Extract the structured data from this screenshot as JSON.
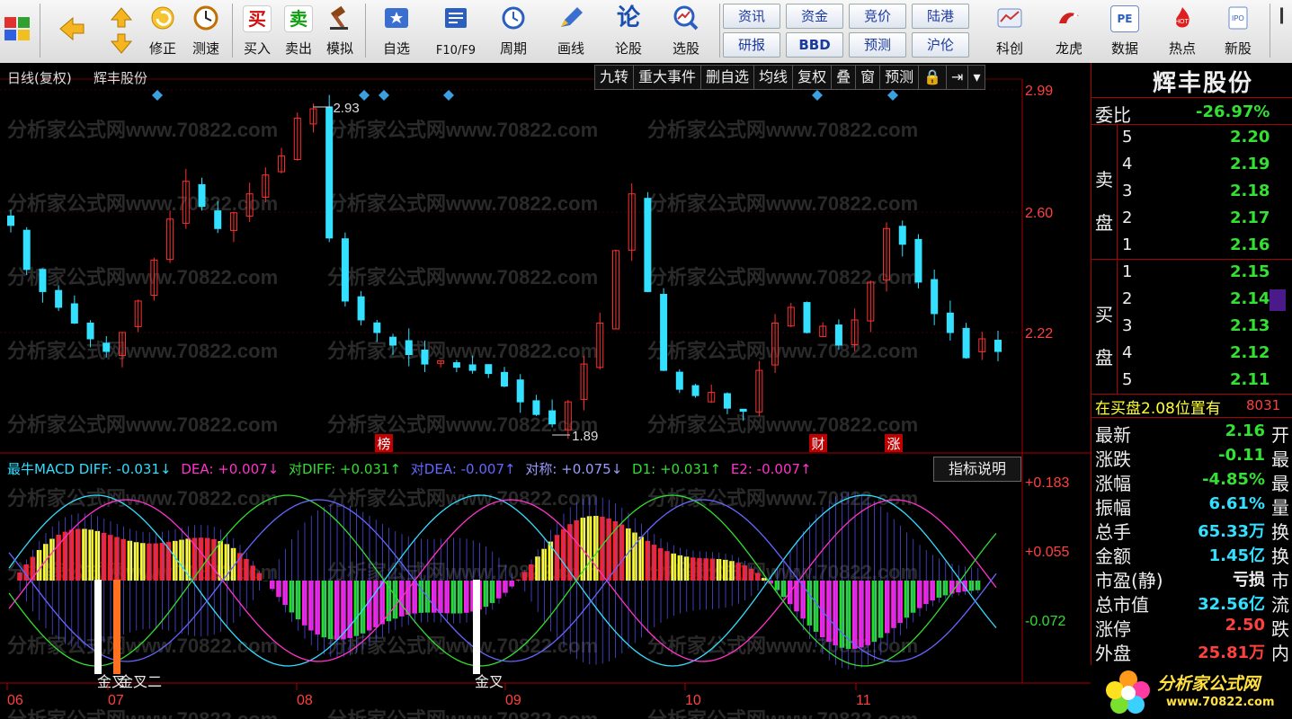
{
  "toolbar": {
    "nav_buttons": [
      {
        "label": "",
        "icon": "app-grid-icon"
      },
      {
        "label": "",
        "icon": "back-arrow-icon"
      },
      {
        "label": "修正",
        "icon": "fix-icon"
      },
      {
        "label": "测速",
        "icon": "clock-icon"
      }
    ],
    "trade_buttons": [
      {
        "label": "买入",
        "glyph": "买",
        "color": "#d01010"
      },
      {
        "label": "卖出",
        "glyph": "卖",
        "color": "#10a010"
      },
      {
        "label": "模拟",
        "glyph": "",
        "color": "#8b4513"
      }
    ],
    "func_buttons": [
      {
        "label": "自选"
      },
      {
        "label": "F10/F9"
      },
      {
        "label": "周期"
      },
      {
        "label": "画线"
      },
      {
        "label": "论股"
      },
      {
        "label": "选股"
      }
    ],
    "small_buttons": [
      [
        "资讯",
        "资金",
        "竞价",
        "陆港"
      ],
      [
        "研报",
        "BBD",
        "预测",
        "沪伦"
      ]
    ],
    "right_buttons": [
      {
        "label": "科创"
      },
      {
        "label": "龙虎"
      },
      {
        "label": "数据"
      },
      {
        "label": "热点"
      },
      {
        "label": "新股"
      }
    ]
  },
  "chart_header": {
    "period": "日线(复权)",
    "stock": "辉丰股份"
  },
  "tabs": [
    "九转",
    "重大事件",
    "删自选",
    "均线",
    "复权",
    "叠",
    "窗",
    "预测",
    "🔒",
    "⇥",
    "▾"
  ],
  "watermark": "分析家公式网www.70822.com",
  "price_axis": {
    "labels": [
      "2.99",
      "2.60",
      "2.22"
    ]
  },
  "price_marks": {
    "high": "2.93",
    "low": "1.89"
  },
  "event_tags": [
    "榜",
    "财",
    "涨"
  ],
  "macd": {
    "legend": [
      {
        "text": "最牛MACD DIFF: -0.031↓",
        "color": "#33ddff"
      },
      {
        "text": "DEA: +0.007↓",
        "color": "#ff33cc"
      },
      {
        "text": "对DIFF: +0.031↑",
        "color": "#33dd33"
      },
      {
        "text": "对DEA: -0.007↑",
        "color": "#6666ff"
      },
      {
        "text": "对称: +0.075↓",
        "color": "#9a9aff"
      },
      {
        "text": "D1: +0.031↑",
        "color": "#33dd33"
      },
      {
        "text": "E2: -0.007↑",
        "color": "#ff33cc"
      }
    ],
    "explain_button": "指标说明",
    "axis_labels": [
      "+0.183",
      "+0.055",
      "-0.072"
    ],
    "signals": [
      "金叉",
      "金叉二",
      "金叉"
    ]
  },
  "x_axis": [
    "06",
    "07",
    "08",
    "09",
    "10",
    "11"
  ],
  "panel": {
    "stock_name": "辉丰股份",
    "weibi_label": "委比",
    "weibi_value": "-26.97%",
    "sell_label": "卖盘",
    "buy_label": "买盘",
    "sell_levels": [
      {
        "level": "5",
        "price": "2.20"
      },
      {
        "level": "4",
        "price": "2.19"
      },
      {
        "level": "3",
        "price": "2.18"
      },
      {
        "level": "2",
        "price": "2.17"
      },
      {
        "level": "1",
        "price": "2.16"
      }
    ],
    "buy_levels": [
      {
        "level": "1",
        "price": "2.15"
      },
      {
        "level": "2",
        "price": "2.14"
      },
      {
        "level": "3",
        "price": "2.13"
      },
      {
        "level": "4",
        "price": "2.12"
      },
      {
        "level": "5",
        "price": "2.11"
      }
    ],
    "notice": "在买盘2.08位置有",
    "notice_value": "8031",
    "stats": [
      {
        "label": "最新",
        "value": "2.16",
        "suffix": "开",
        "color": "#33e033"
      },
      {
        "label": "涨跌",
        "value": "-0.11",
        "suffix": "最",
        "color": "#33e033"
      },
      {
        "label": "涨幅",
        "value": "-4.85%",
        "suffix": "最",
        "color": "#33e033"
      },
      {
        "label": "振幅",
        "value": "6.61%",
        "suffix": "量",
        "color": "#33e0ff"
      },
      {
        "label": "总手",
        "value": "65.33万",
        "suffix": "换",
        "color": "#33e0ff"
      },
      {
        "label": "金额",
        "value": "1.45亿",
        "suffix": "换",
        "color": "#33e0ff"
      },
      {
        "label": "市盈(静)",
        "value": "亏损",
        "suffix": "市",
        "color": "#eeeeee"
      },
      {
        "label": "总市值",
        "value": "32.56亿",
        "suffix": "流",
        "color": "#33e0ff"
      },
      {
        "label": "涨停",
        "value": "2.50",
        "suffix": "跌",
        "color": "#ff4040"
      },
      {
        "label": "外盘",
        "value": "25.81万",
        "suffix": "内",
        "color": "#ff4040"
      }
    ],
    "logo_text": "分析家公式网",
    "logo_url": "www.70822.com"
  }
}
